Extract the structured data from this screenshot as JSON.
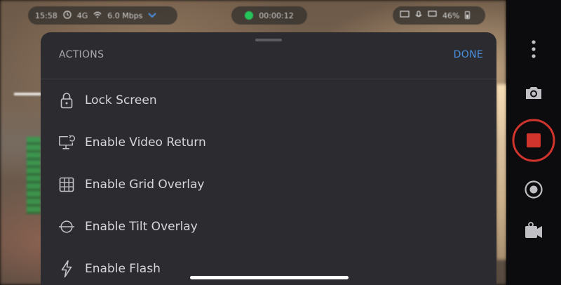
{
  "status_bar": {
    "time": "15:58",
    "network": "4G",
    "bitrate": "6.0 Mbps",
    "rec_timer": "00:00:12",
    "battery": "46%"
  },
  "sheet": {
    "title": "ACTIONS",
    "done_label": "DONE",
    "items": [
      {
        "label": "Lock Screen",
        "icon": "lock-icon"
      },
      {
        "label": "Enable Video Return",
        "icon": "video-return-icon"
      },
      {
        "label": "Enable Grid Overlay",
        "icon": "grid-icon"
      },
      {
        "label": "Enable Tilt Overlay",
        "icon": "tilt-icon"
      },
      {
        "label": "Enable Flash",
        "icon": "flash-icon"
      }
    ]
  },
  "controls": {
    "more_icon": "more-vertical-icon",
    "camera_icon": "camera-icon",
    "stop_icon": "stop-record-icon",
    "target_icon": "target-icon",
    "switch_camera_icon": "switch-camera-icon"
  },
  "colors": {
    "sheet_bg": "#2c2c30",
    "accent": "#4a90e2",
    "record_red": "#d0342c",
    "rec_green": "#26c25a"
  }
}
